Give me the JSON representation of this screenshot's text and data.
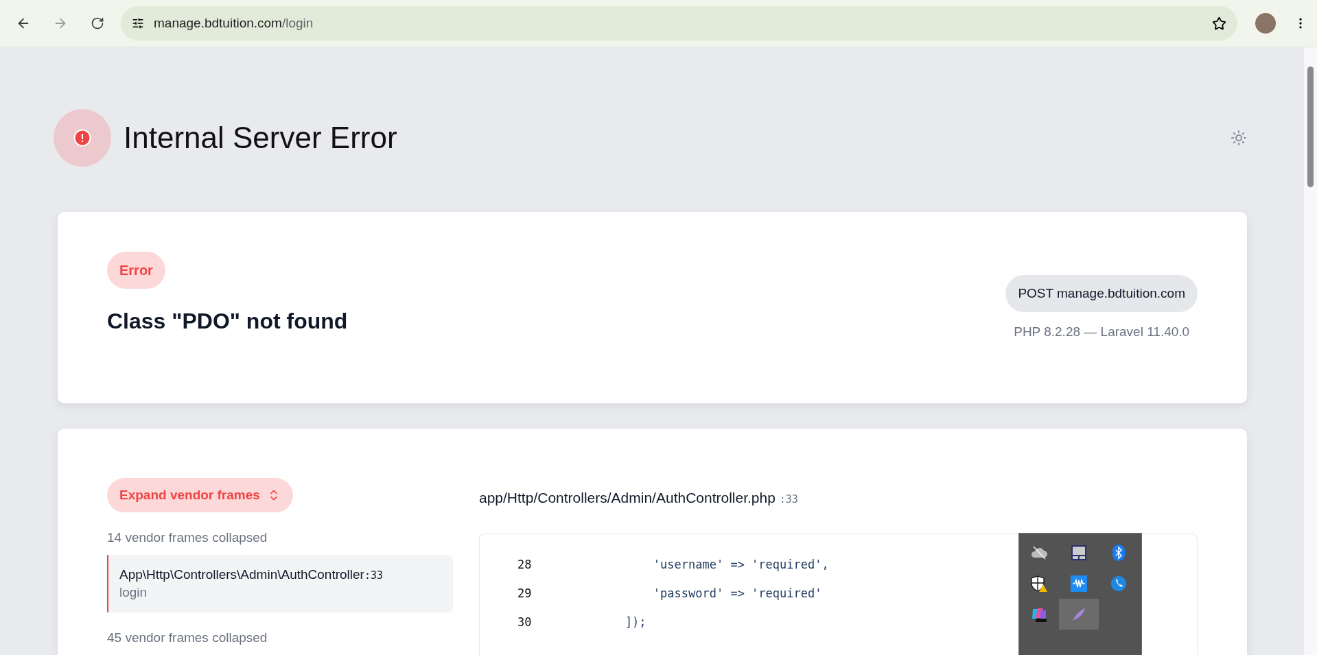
{
  "browser": {
    "url_host": "manage.bdtuition.com",
    "url_path": "/login"
  },
  "header": {
    "title": "Internal Server Error"
  },
  "summary": {
    "badge": "Error",
    "message": "Class \"PDO\" not found",
    "request": "POST manage.bdtuition.com",
    "versions": "PHP 8.2.28 — Laravel 11.40.0"
  },
  "trace": {
    "expand_button": "Expand vendor frames",
    "frames": [
      {
        "kind": "collapsed",
        "text": "14 vendor frames collapsed"
      },
      {
        "kind": "frame",
        "class_name": "App\\Http\\Controllers\\Admin\\AuthController",
        "line": ":33",
        "method": "login",
        "selected": true
      },
      {
        "kind": "collapsed",
        "text": "45 vendor frames collapsed"
      }
    ],
    "file": {
      "path": "app/Http/Controllers/Admin/AuthController.php",
      "line": ":33"
    },
    "code": [
      {
        "number": "28",
        "text": "            'username' => 'required',"
      },
      {
        "number": "29",
        "text": "            'password' => 'required'"
      },
      {
        "number": "30",
        "text": "        ]);"
      }
    ]
  },
  "tray": {
    "icons": [
      {
        "kind": "cloud-off",
        "highlighted": false
      },
      {
        "kind": "touchpad",
        "highlighted": false
      },
      {
        "kind": "bluetooth",
        "highlighted": false
      },
      {
        "kind": "shield-warning",
        "highlighted": false
      },
      {
        "kind": "waves",
        "highlighted": false
      },
      {
        "kind": "phone",
        "highlighted": false
      },
      {
        "kind": "m365",
        "highlighted": false
      },
      {
        "kind": "feather",
        "highlighted": true
      }
    ]
  }
}
